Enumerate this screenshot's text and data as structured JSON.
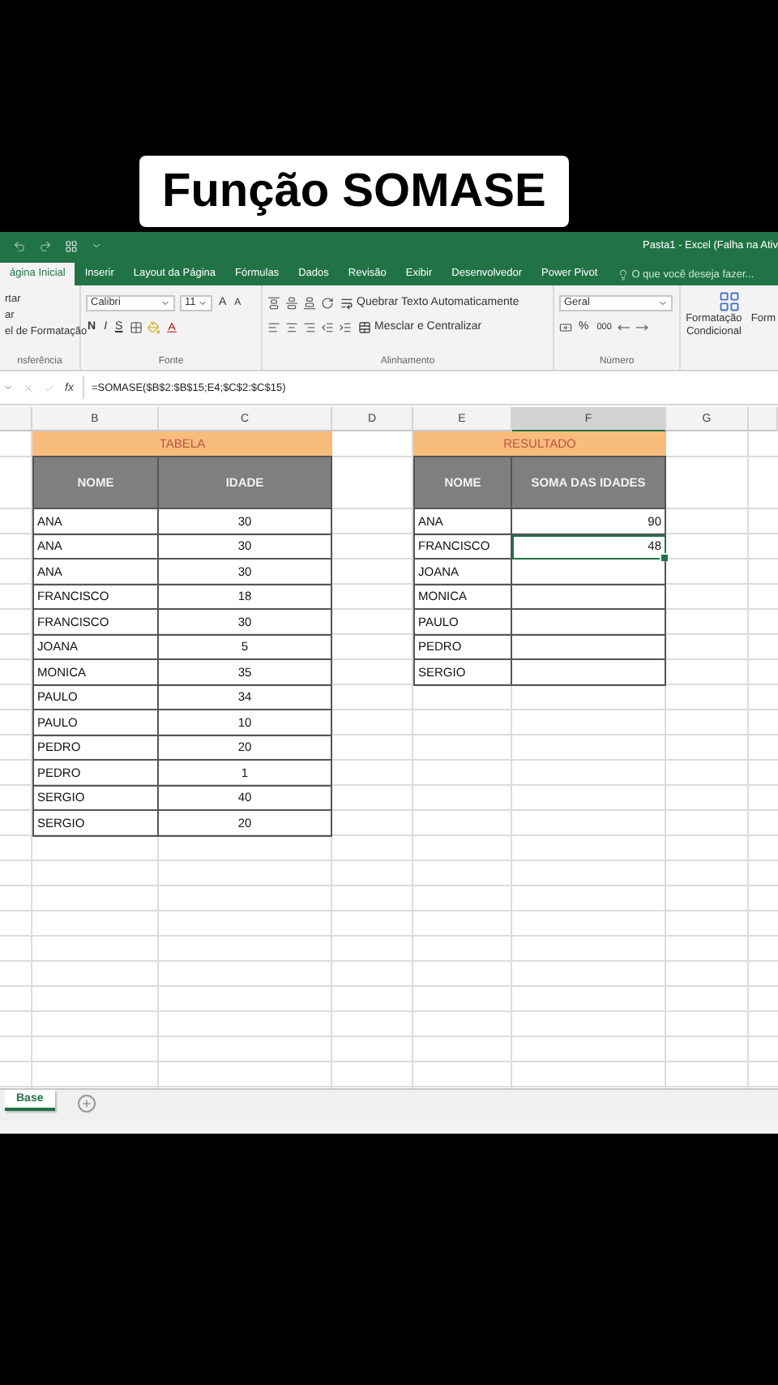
{
  "caption": "Função SOMASE",
  "title_bar": {
    "title": "Pasta1 - Excel (Falha na Ativ"
  },
  "ribbon_tabs": [
    {
      "label": "ágina Inicial",
      "selected": true
    },
    {
      "label": "Inserir",
      "selected": false
    },
    {
      "label": "Layout da Página",
      "selected": false
    },
    {
      "label": "Fórmulas",
      "selected": false
    },
    {
      "label": "Dados",
      "selected": false
    },
    {
      "label": "Revisão",
      "selected": false
    },
    {
      "label": "Exibir",
      "selected": false
    },
    {
      "label": "Desenvolvedor",
      "selected": false
    },
    {
      "label": "Power Pivot",
      "selected": false
    }
  ],
  "tell_me": {
    "placeholder": "O que você deseja fazer..."
  },
  "ribbon": {
    "clipboard": {
      "lines": [
        "rtar",
        "ar",
        "el de Formatação"
      ],
      "label": "nsferência"
    },
    "font": {
      "name": "Calibri",
      "size": "11",
      "grow": "A",
      "shrink": "A",
      "bold": "N",
      "italic": "I",
      "underline": "S",
      "label": "Fonte"
    },
    "alignment": {
      "wrap": "Quebrar Texto Automaticamente",
      "merge": "Mesclar e Centralizar",
      "label": "Alinhamento"
    },
    "number": {
      "format": "Geral",
      "percent": "%",
      "thousands": "000",
      "label": "Número"
    },
    "styles": {
      "conditional": "Formatação Condicional",
      "format_cut": "Form"
    }
  },
  "formula_bar": {
    "fx": "fx",
    "formula": "=SOMASE($B$2:$B$15;E4;$C$2:$C$15)"
  },
  "columns": [
    {
      "label": "B",
      "selected": false
    },
    {
      "label": "C",
      "selected": false
    },
    {
      "label": "D",
      "selected": false
    },
    {
      "label": "E",
      "selected": false
    },
    {
      "label": "F",
      "selected": true
    },
    {
      "label": "G",
      "selected": false
    }
  ],
  "tabela": {
    "title": "TABELA",
    "headers": [
      "NOME",
      "IDADE"
    ],
    "rows": [
      {
        "name": "ANA",
        "age": "30"
      },
      {
        "name": "ANA",
        "age": "30"
      },
      {
        "name": "ANA",
        "age": "30"
      },
      {
        "name": "FRANCISCO",
        "age": "18"
      },
      {
        "name": "FRANCISCO",
        "age": "30"
      },
      {
        "name": "JOANA",
        "age": "5"
      },
      {
        "name": "MONICA",
        "age": "35"
      },
      {
        "name": "PAULO",
        "age": "34"
      },
      {
        "name": "PAULO",
        "age": "10"
      },
      {
        "name": "PEDRO",
        "age": "20"
      },
      {
        "name": "PEDRO",
        "age": "1"
      },
      {
        "name": "SERGIO",
        "age": "40"
      },
      {
        "name": "SERGIO",
        "age": "20"
      }
    ]
  },
  "resultado": {
    "title": "RESULTADO",
    "headers": [
      "NOME",
      "SOMA DAS IDADES"
    ],
    "rows": [
      {
        "name": "ANA",
        "sum": "90",
        "selected": false
      },
      {
        "name": "FRANCISCO",
        "sum": "48",
        "selected": true
      },
      {
        "name": "JOANA",
        "selected": false
      },
      {
        "name": "MONICA",
        "selected": false
      },
      {
        "name": "PAULO",
        "selected": false
      },
      {
        "name": "PEDRO",
        "selected": false
      },
      {
        "name": "SERGIO",
        "selected": false
      }
    ]
  },
  "sheets": [
    {
      "label": "Base",
      "selected": true
    }
  ]
}
